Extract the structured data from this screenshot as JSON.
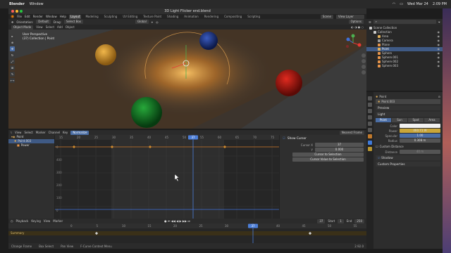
{
  "mac_menu": {
    "app": "Blender",
    "items": [
      "Window"
    ],
    "date": "Wed Mar 24",
    "time": "2:09 PM"
  },
  "window": {
    "title": "3D Light Flicker end.blend"
  },
  "topbar": {
    "menus": [
      "File",
      "Edit",
      "Render",
      "Window",
      "Help"
    ],
    "workspaces": [
      "Layout",
      "Modeling",
      "Sculpting",
      "UV Editing",
      "Texture Paint",
      "Shading",
      "Animation",
      "Rendering",
      "Compositing",
      "Scripting"
    ],
    "active_workspace": "Layout",
    "scene": "Scene",
    "view_layer": "View Layer"
  },
  "tool_header": {
    "orientation_label": "Orientation:",
    "orientation": "Default",
    "drag_label": "Drag:",
    "drag": "Select Box",
    "transform": "Global",
    "options": "Options"
  },
  "view_header": {
    "mode": "Object Mode",
    "menus": [
      "View",
      "Select",
      "Add",
      "Object"
    ]
  },
  "viewport": {
    "view_name": "User Perspective",
    "collection": "(37) Collection | Point"
  },
  "graph_header": {
    "menus": [
      "View",
      "Select",
      "Marker",
      "Channel",
      "Key"
    ],
    "mode": "Normalize",
    "pivot": "Nearest Frame"
  },
  "graph": {
    "ruler": [
      "15",
      "20",
      "25",
      "30",
      "35",
      "40",
      "45",
      "50",
      "55",
      "60",
      "65",
      "70",
      "75"
    ],
    "current_frame": "37",
    "y_labels": [
      "0",
      "400",
      "300",
      "200",
      "100",
      "0"
    ],
    "channels": [
      {
        "name": "Point",
        "kind": "object"
      },
      {
        "name": "Point.003",
        "kind": "data"
      },
      {
        "name": "Power",
        "kind": "fcurve"
      }
    ]
  },
  "graph_sidebar": {
    "section": "Show Cursor",
    "cursor_x_label": "Cursor X",
    "cursor_x": "37",
    "cursor_y_label": "Y",
    "cursor_y": "0.000",
    "btn_cursor_to_selection": "Cursor to Selection",
    "btn_cursor_value": "Cursor Value to Selection"
  },
  "timeline_header": {
    "menus": [
      "Playback",
      "Keying",
      "View",
      "Marker"
    ],
    "current_frame": "37",
    "start_label": "Start",
    "start": "1",
    "end_label": "End",
    "end": "250"
  },
  "timeline": {
    "ruler": [
      "0",
      "5",
      "10",
      "15",
      "20",
      "25",
      "30",
      "35",
      "40",
      "45",
      "50",
      "55"
    ],
    "current_frame": "37",
    "summary": "Summary"
  },
  "statusbar": {
    "items": [
      "Change Frame",
      "Box Select",
      "Pan View",
      "F-Curve Context Menu"
    ],
    "version": "2.92.0"
  },
  "outliner": {
    "rows": [
      {
        "name": "Scene Collection",
        "depth": 0,
        "color": "#cccccc",
        "selected": false
      },
      {
        "name": "Collection",
        "depth": 1,
        "color": "#cccccc",
        "selected": false
      },
      {
        "name": "Area",
        "depth": 2,
        "color": "#e3b15a",
        "selected": false
      },
      {
        "name": "Camera",
        "depth": 2,
        "color": "#9b9b9b",
        "selected": false
      },
      {
        "name": "Plane",
        "depth": 2,
        "color": "#e8954a",
        "selected": false
      },
      {
        "name": "Point",
        "depth": 2,
        "color": "#e3b15a",
        "selected": true
      },
      {
        "name": "Sphere",
        "depth": 2,
        "color": "#e8954a",
        "selected": false
      },
      {
        "name": "Sphere.001",
        "depth": 2,
        "color": "#e8954a",
        "selected": false
      },
      {
        "name": "Sphere.002",
        "depth": 2,
        "color": "#e8954a",
        "selected": false
      },
      {
        "name": "Sphere.003",
        "depth": 2,
        "color": "#e8954a",
        "selected": false
      }
    ]
  },
  "properties": {
    "object": "Point",
    "data": "Point.003",
    "sections": {
      "preview": "Preview",
      "light": "Light",
      "custom_distance": "Custom Distance",
      "shadow": "Shadow",
      "custom_props": "Custom Properties"
    },
    "light_types": [
      "Point",
      "Sun",
      "Spot",
      "Area"
    ],
    "active_light_type": "Point",
    "fields": [
      {
        "label": "Color",
        "value": "",
        "color": "#f2f2f2"
      },
      {
        "label": "Power",
        "value": "460.71 W",
        "color": "#c9a63a"
      },
      {
        "label": "Specular",
        "value": "1.00",
        "color": "#4b6ea5"
      },
      {
        "label": "Radius",
        "value": "0.308 m",
        "color": "#545454"
      }
    ],
    "distance_label": "Distance",
    "distance": "40 m"
  }
}
